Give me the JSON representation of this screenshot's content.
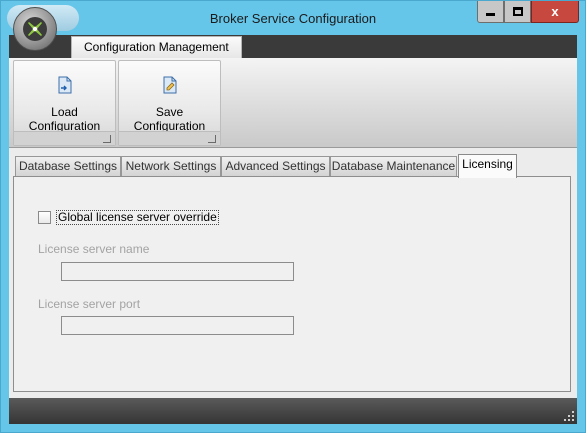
{
  "window": {
    "title": "Broker Service Configuration",
    "accent_color": "#66c6ea",
    "close_color": "#c7483f"
  },
  "caption_buttons": {
    "minimize_icon": "minimize-icon",
    "maximize_icon": "maximize-icon",
    "close_label": "x"
  },
  "ribbon": {
    "tab_label": "Configuration Management",
    "buttons": [
      {
        "label": "Load Configuration",
        "icon": "load-document-icon"
      },
      {
        "label": "Save Configuration",
        "icon": "save-document-icon"
      }
    ]
  },
  "tabs": [
    {
      "label": "Database Settings",
      "active": false
    },
    {
      "label": "Network Settings",
      "active": false
    },
    {
      "label": "Advanced Settings",
      "active": false
    },
    {
      "label": "Database Maintenance",
      "active": false
    },
    {
      "label": "Licensing",
      "active": true
    }
  ],
  "licensing": {
    "override_label": "Global license server override",
    "override_checked": false,
    "server_name_label": "License server name",
    "server_name_value": "",
    "server_port_label": "License server port",
    "server_port_value": ""
  }
}
